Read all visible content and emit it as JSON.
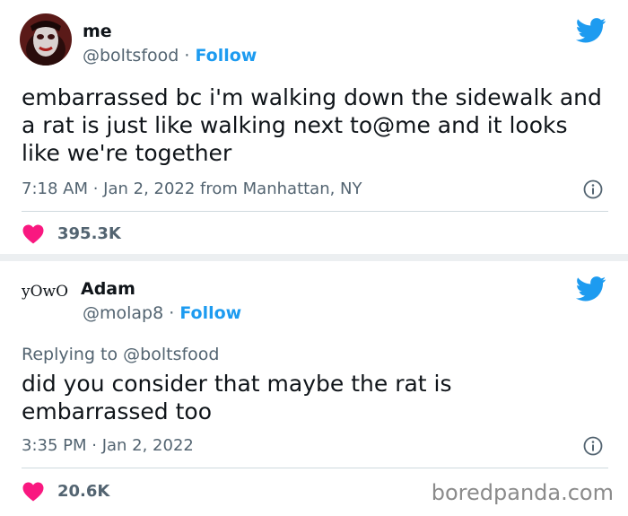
{
  "tweets": [
    {
      "display_name": "me",
      "handle": "@boltsfood",
      "follow_label": "Follow",
      "text": "embarrassed bc i'm walking down the sidewalk and a rat is just like walking next to@me and it looks like we're together",
      "meta": "7:18 AM · Jan 2, 2022 from Manhattan, NY",
      "likes": "395.3K"
    },
    {
      "display_name": "Adam",
      "avatar_text": "yOwO",
      "handle": "@molap8",
      "follow_label": "Follow",
      "replying_to": "Replying to @boltsfood",
      "text": "did you consider that maybe the rat is embarrassed too",
      "meta": "3:35 PM · Jan 2, 2022",
      "likes": "20.6K"
    }
  ],
  "separator": " · ",
  "watermark": "boredpanda.com",
  "colors": {
    "accent": "#1d9bf0",
    "heart": "#f91880",
    "muted": "#536471"
  }
}
